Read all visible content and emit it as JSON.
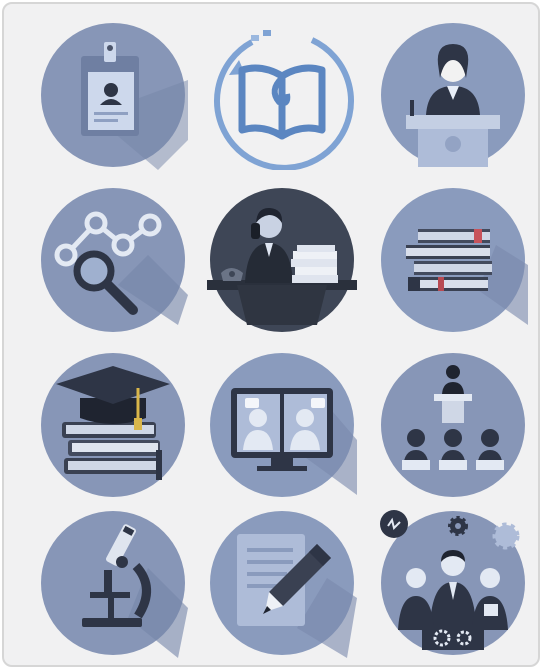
{
  "icons": [
    {
      "name": "id-badge-icon"
    },
    {
      "name": "open-book-refresh-icon"
    },
    {
      "name": "speaker-at-podium-icon"
    },
    {
      "name": "analytics-magnifier-icon"
    },
    {
      "name": "busy-office-worker-icon"
    },
    {
      "name": "stack-of-books-icon"
    },
    {
      "name": "graduation-cap-books-icon"
    },
    {
      "name": "video-conference-icon"
    },
    {
      "name": "lecture-audience-icon"
    },
    {
      "name": "microscope-icon"
    },
    {
      "name": "document-edit-icon"
    },
    {
      "name": "business-team-icon"
    }
  ],
  "colors": {
    "background": "#f1f1f2",
    "circle": "#8a9bbd",
    "circle_dark": "#3e4656",
    "accent_blue": "#6f95c8",
    "dark": "#2f3440",
    "light": "#e3e9f3"
  }
}
